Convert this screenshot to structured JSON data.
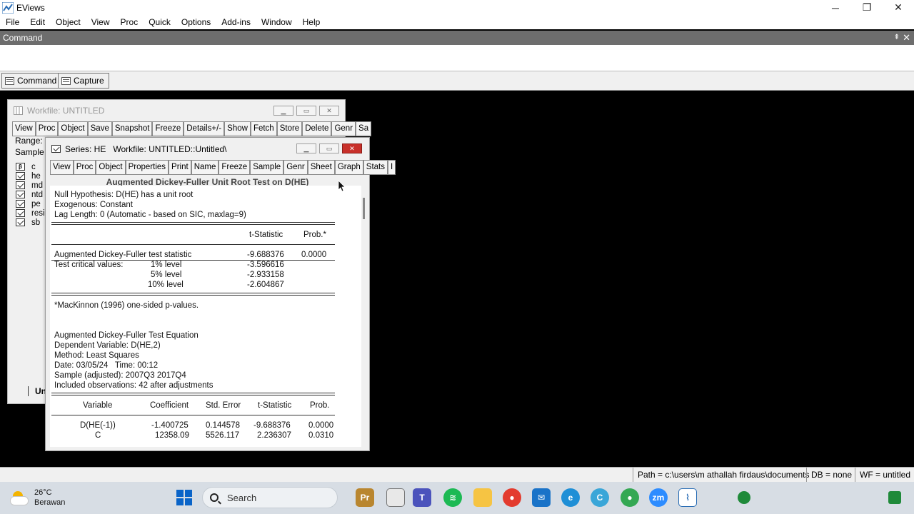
{
  "app": {
    "title": "EViews"
  },
  "window_controls": {
    "minimize": "─",
    "maximize": "❐",
    "close": "✕"
  },
  "menu": [
    "File",
    "Edit",
    "Object",
    "View",
    "Proc",
    "Quick",
    "Options",
    "Add-ins",
    "Window",
    "Help"
  ],
  "command_pane": {
    "header": "Command",
    "pin": "⇞",
    "close": "✕",
    "tabs": [
      "Command",
      "Capture"
    ]
  },
  "workfile_window": {
    "title": "Workfile: UNTITLED",
    "toolbar": [
      "View",
      "Proc",
      "Object",
      "Save",
      "Snapshot",
      "Freeze",
      "Details+/-",
      "Show",
      "Fetch",
      "Store",
      "Delete",
      "Genr",
      "Sa"
    ],
    "range_label": "Range:",
    "sample_label": "Sample",
    "objects": [
      {
        "name": "c",
        "icon": "beta-icon"
      },
      {
        "name": "he",
        "icon": "series-icon"
      },
      {
        "name": "md",
        "icon": "series-icon"
      },
      {
        "name": "ntd",
        "icon": "series-icon"
      },
      {
        "name": "pe",
        "icon": "series-icon"
      },
      {
        "name": "resi",
        "icon": "series-icon"
      },
      {
        "name": "sb",
        "icon": "series-icon"
      }
    ],
    "bottom_tab": "Un"
  },
  "series_window": {
    "title": "Series: HE   Workfile: UNTITLED::Untitled\\",
    "toolbar": [
      "View",
      "Proc",
      "Object",
      "Properties",
      "Print",
      "Name",
      "Freeze",
      "Sample",
      "Genr",
      "Sheet",
      "Graph",
      "Stats",
      "I"
    ],
    "heading": "Augmented Dickey-Fuller Unit Root Test on D(HE)",
    "output": {
      "null_hypothesis": "Null Hypothesis: D(HE) has a unit root",
      "exogenous": "Exogenous: Constant",
      "lag_length": "Lag Length: 0 (Automatic - based on SIC, maxlag=9)",
      "col_tstat": "t-Statistic",
      "col_prob": "Prob.*",
      "adf_label": "Augmented Dickey-Fuller test statistic",
      "adf_tstat": "-9.688376",
      "adf_prob": "0.0000",
      "critical_label": "Test critical values:",
      "levels": [
        {
          "level": "1% level",
          "value": "-3.596616"
        },
        {
          "level": "5% level",
          "value": "-2.933158"
        },
        {
          "level": "10% level",
          "value": "-2.604867"
        }
      ],
      "footnote": "*MacKinnon (1996) one-sided p-values.",
      "eq_title": "Augmented Dickey-Fuller Test Equation",
      "dep_var": "Dependent Variable: D(HE,2)",
      "method": "Method: Least Squares",
      "date": "Date: 03/05/24   Time: 00:12",
      "sample": "Sample (adjusted): 2007Q3 2017Q4",
      "included": "Included observations: 42 after adjustments",
      "table_headers": [
        "Variable",
        "Coefficient",
        "Std. Error",
        "t-Statistic",
        "Prob."
      ],
      "rows": [
        [
          "D(HE(-1))",
          "-1.400725",
          "0.144578",
          "-9.688376",
          "0.0000"
        ],
        [
          "C",
          "12358.09",
          "5526.117",
          "2.236307",
          "0.0310"
        ]
      ]
    }
  },
  "statusbar": {
    "path": "Path = c:\\users\\m athallah firdaus\\documents",
    "db": "DB = none",
    "wf": "WF = untitled"
  },
  "taskbar": {
    "weather_temp": "26°C",
    "weather_desc": "Berawan",
    "search_placeholder": "Search",
    "colors": {
      "taskbar_bg": "#d7dde4",
      "accent": "#0a64c8"
    }
  }
}
